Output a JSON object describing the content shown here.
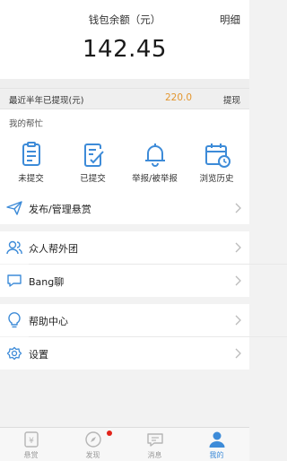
{
  "wallet": {
    "title": "钱包余额（元）",
    "detail_label": "明细",
    "balance": "142.45"
  },
  "withdraw": {
    "label": "最近半年已提现(元)",
    "value": "220.0",
    "button": "提现"
  },
  "my_help": {
    "title": "我的帮忙",
    "items": [
      {
        "icon": "clipboard-icon",
        "label": "未提交"
      },
      {
        "icon": "checklist-icon",
        "label": "已提交"
      },
      {
        "icon": "bell-icon",
        "label": "举报/被举报"
      },
      {
        "icon": "calendar-icon",
        "label": "浏览历史"
      }
    ]
  },
  "menu": {
    "publish": {
      "icon": "paper-plane-icon",
      "label": "发布/管理悬赏"
    },
    "helpers": {
      "icon": "group-icon",
      "label": "众人帮外团"
    },
    "bang_chat": {
      "icon": "chat-icon",
      "label": "Bang聊"
    },
    "help_center": {
      "icon": "lightbulb-icon",
      "label": "帮助中心"
    },
    "settings": {
      "icon": "gear-icon",
      "label": "设置"
    }
  },
  "tabbar": {
    "tabs": [
      {
        "icon": "reward-icon",
        "label": "悬赏"
      },
      {
        "icon": "discover-icon",
        "label": "发现"
      },
      {
        "icon": "message-icon",
        "label": "消息"
      },
      {
        "icon": "profile-icon",
        "label": "我的"
      }
    ],
    "active_index": 3
  },
  "colors": {
    "accent_blue": "#3d8bd8",
    "withdraw_orange": "#e3962e",
    "badge_red": "#e2231a"
  }
}
